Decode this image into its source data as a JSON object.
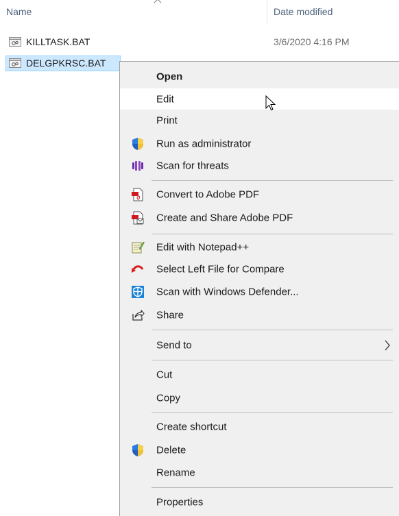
{
  "columns": {
    "name": "Name",
    "date_modified": "Date modified"
  },
  "files": [
    {
      "name": "KILLTASK.BAT",
      "date": "3/6/2020 4:16 PM",
      "selected": false
    },
    {
      "name": "DELGPKRSC.BAT",
      "date": "",
      "selected": true
    }
  ],
  "context_menu": {
    "items": [
      {
        "label": "Open",
        "bold": true,
        "icon": ""
      },
      {
        "label": "Edit",
        "icon": "",
        "hover": true
      },
      {
        "label": "Print",
        "icon": ""
      },
      {
        "label": "Run as administrator",
        "icon": "uac-shield-icon"
      },
      {
        "label": "Scan for threats",
        "icon": "malwarebytes-icon"
      },
      {
        "label": "Convert to Adobe PDF",
        "icon": "adobe-pdf-icon"
      },
      {
        "label": "Create and Share Adobe PDF",
        "icon": "adobe-share-pdf-icon"
      },
      {
        "label": "Edit with Notepad++",
        "icon": "notepadpp-icon"
      },
      {
        "label": "Select Left File for Compare",
        "icon": "compare-icon"
      },
      {
        "label": "Scan with Windows Defender...",
        "icon": "windows-defender-icon"
      },
      {
        "label": "Share",
        "icon": "share-icon"
      },
      {
        "label": "Send to",
        "icon": "",
        "submenu": true
      },
      {
        "label": "Cut",
        "icon": ""
      },
      {
        "label": "Copy",
        "icon": ""
      },
      {
        "label": "Create shortcut",
        "icon": ""
      },
      {
        "label": "Delete",
        "icon": "uac-shield-icon"
      },
      {
        "label": "Rename",
        "icon": ""
      },
      {
        "label": "Properties",
        "icon": ""
      }
    ]
  },
  "colors": {
    "selection_bg": "#cce8ff",
    "selection_border": "#99d1ff",
    "menu_bg": "#f0f0f0",
    "hover_bg": "#ffffff",
    "header_text": "#4c607a"
  }
}
